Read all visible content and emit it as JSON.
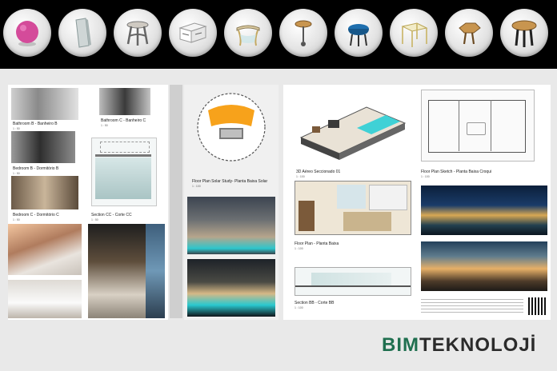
{
  "toolbar": {
    "items": [
      {
        "icon": "sphere-icon",
        "color": "#d44b9a"
      },
      {
        "icon": "glass-panel-icon"
      },
      {
        "icon": "side-table-icon"
      },
      {
        "icon": "cabinet-icon"
      },
      {
        "icon": "console-table-icon"
      },
      {
        "icon": "round-stool-icon"
      },
      {
        "icon": "blue-table-icon",
        "color": "#1f6fae"
      },
      {
        "icon": "square-table-icon"
      },
      {
        "icon": "hex-table-icon"
      },
      {
        "icon": "round-wood-table-icon"
      }
    ]
  },
  "sheet_left": {
    "labels": {
      "bathroom_b": "Bathroom B - Banheiro B",
      "bathroom_c": "Bathroom C - Banheiro C",
      "bedroom_b": "Bedroom B - Dormitório B",
      "bedroom_c": "Bedroom C - Dormitório C",
      "section_cc": "Section CC - Corte CC"
    },
    "scale": "1 : 50"
  },
  "sheet_mid": {
    "title": "Floor Plan Solar Study- Planta Baixa Solar",
    "scale": "1 : 100"
  },
  "sheet_right": {
    "labels": {
      "aereo": "3D Aéreo Seccionado 01",
      "sketch": "Floor Plan Sketch - Planta Baixa Croqui",
      "floor_plan": "Floor Plan - Planta Baixa",
      "section_bb": "Section BB - Corte BB"
    },
    "scale": "1 : 100"
  },
  "brand": {
    "part1": "BIM",
    "part2": "TEKNOLOJİ"
  },
  "colors": {
    "brand_green": "#1f6f4f",
    "solar_orange": "#f7a21b",
    "water_teal": "#3fd1d6"
  }
}
